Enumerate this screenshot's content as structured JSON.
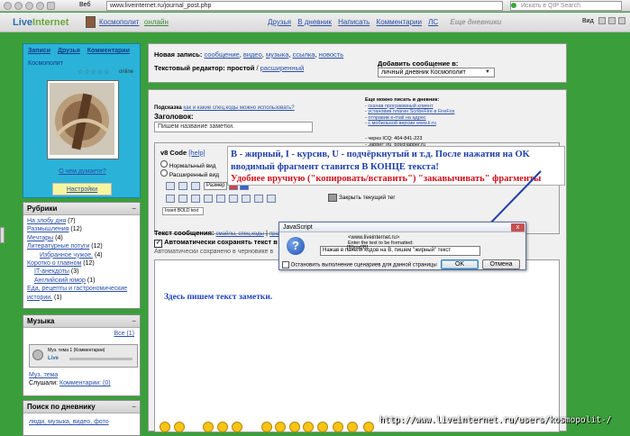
{
  "browser": {
    "tab_label": "Веб",
    "url": "www.liveinternet.ru/journal_post.php",
    "search_placeholder": "Искать в QIP Search"
  },
  "header": {
    "logo_live": "Live",
    "logo_internet": "Internet",
    "username": "Космополит",
    "status": "онлайн",
    "nav": [
      "Друзья",
      "В дневник",
      "Написать",
      "Комментарии",
      "ЛС"
    ],
    "nav_extra": "Еще дневники",
    "view_label": "Вид"
  },
  "sidebar": {
    "profile_links": [
      "Записи",
      "Друзья",
      "Комментарии"
    ],
    "profile_name": "Космополит",
    "online_label": "online",
    "thinking_link": "О чем думаете?",
    "settings_button": "Настройки",
    "rubrics_title": "Рубрики",
    "rubrics": [
      {
        "label": "На злобу дня",
        "count": "(7)"
      },
      {
        "label": "Размышления",
        "count": "(12)"
      },
      {
        "label": "Мечтары",
        "count": "(4)"
      },
      {
        "label": "Литературные потуги",
        "count": "(12)"
      },
      {
        "label": "Избранное чужое.",
        "count": "(4)"
      },
      {
        "label": "Коротко о главном",
        "count": "(12)"
      },
      {
        "label": "IT-анекдоты",
        "count": "(3)"
      },
      {
        "label": "Английский юмор",
        "count": "(1)"
      },
      {
        "label": "Еда, рецепты и гастрономические истории.",
        "count": "(1)"
      }
    ],
    "music_title": "Музыка",
    "music_link": "Все (1)",
    "player_text": "Муз. тема 1 (Комментарии)",
    "player_brand": "Live",
    "music_track": "Муз. тема",
    "listeners_label": "Слушали:",
    "listeners_link": "Комментарии: (0)",
    "search_title": "Поиск по дневнику",
    "search_tags": "люди, музыка, видео, фото"
  },
  "editor": {
    "new_post_label": "Новая запись:",
    "post_types": [
      "сообщение",
      "видео",
      "музыка",
      "ссылка",
      "новость"
    ],
    "text_editor_label": "Текстовый редактор:",
    "editor_simple": "простой",
    "editor_extended": "расширенный",
    "add_message_label": "Добавить сообщение в:",
    "destination_value": "личный дневник Космополит",
    "hint_label": "Подсказка",
    "hint_link": "как и какие спец.коды можно использовать?",
    "title_label": "Заголовок:",
    "title_placeholder": "Пишем название заметки.",
    "v8_label": "v8 Code",
    "help_link": "[help]",
    "mode_normal": "Нормальный вид",
    "mode_extended": "Расширенный вид",
    "size_label": "Размер",
    "close_tag_label": "Закрыть текущий тег",
    "code_field_value": "Insert BOLD text",
    "message_label": "Текст сообщения:",
    "message_link1": "смайлы, спец.коды",
    "message_link2": "правила",
    "autosave_label": "Автоматически сохранять текст в",
    "autosave_note": "Автоматически сохранено в черновике в",
    "body_text": "Здесь пишем текст заметки."
  },
  "also_post": {
    "title": "Еще можно писать в дневник:",
    "links": [
      "скачав программный клиент",
      "установив плагин ScribeFire в FireFox",
      "отправив e-mail на адрес",
      "с мобильной версии www.li.ru"
    ],
    "icq_line": "через ICQ: 464-841-223",
    "jabber_line": "Jabber: lru_bot@jabber.ru"
  },
  "annotation": {
    "line1": "B - жирный, I - курсив, U - подчёркнутый и т.д. После нажатия на OK",
    "line2": "вводимый фрагмент ставится В КОНЦЕ текста!",
    "line3": "Удобнее вручную (\"копировать/вставить\") \"закавычивать\" фрагменты"
  },
  "dialog": {
    "title": "JavaScript",
    "close_label": "x",
    "site": "<www.liveinternet.ru>",
    "prompt_line1": "Enter the text to be formatted:",
    "prompt_line2": "[B]xxx[/B]",
    "input_value": "Нажав в панели кодов на B, пишем \"жирный\" текст",
    "stop_scripts_label": "Остановить выполнение сценариев для данной страницы",
    "ok_label": "OK",
    "cancel_label": "Отмена"
  },
  "footer_url": "http://www.liveinternet.ru/users/kosmopolit-/",
  "colors": {
    "page_green": "#3a9f3a",
    "annotation_blue": "#1f3fa8",
    "annotation_red": "#d0101a",
    "sidebar_cyan": "#2ab2d8",
    "settings_yellow": "#f7f4a0"
  }
}
